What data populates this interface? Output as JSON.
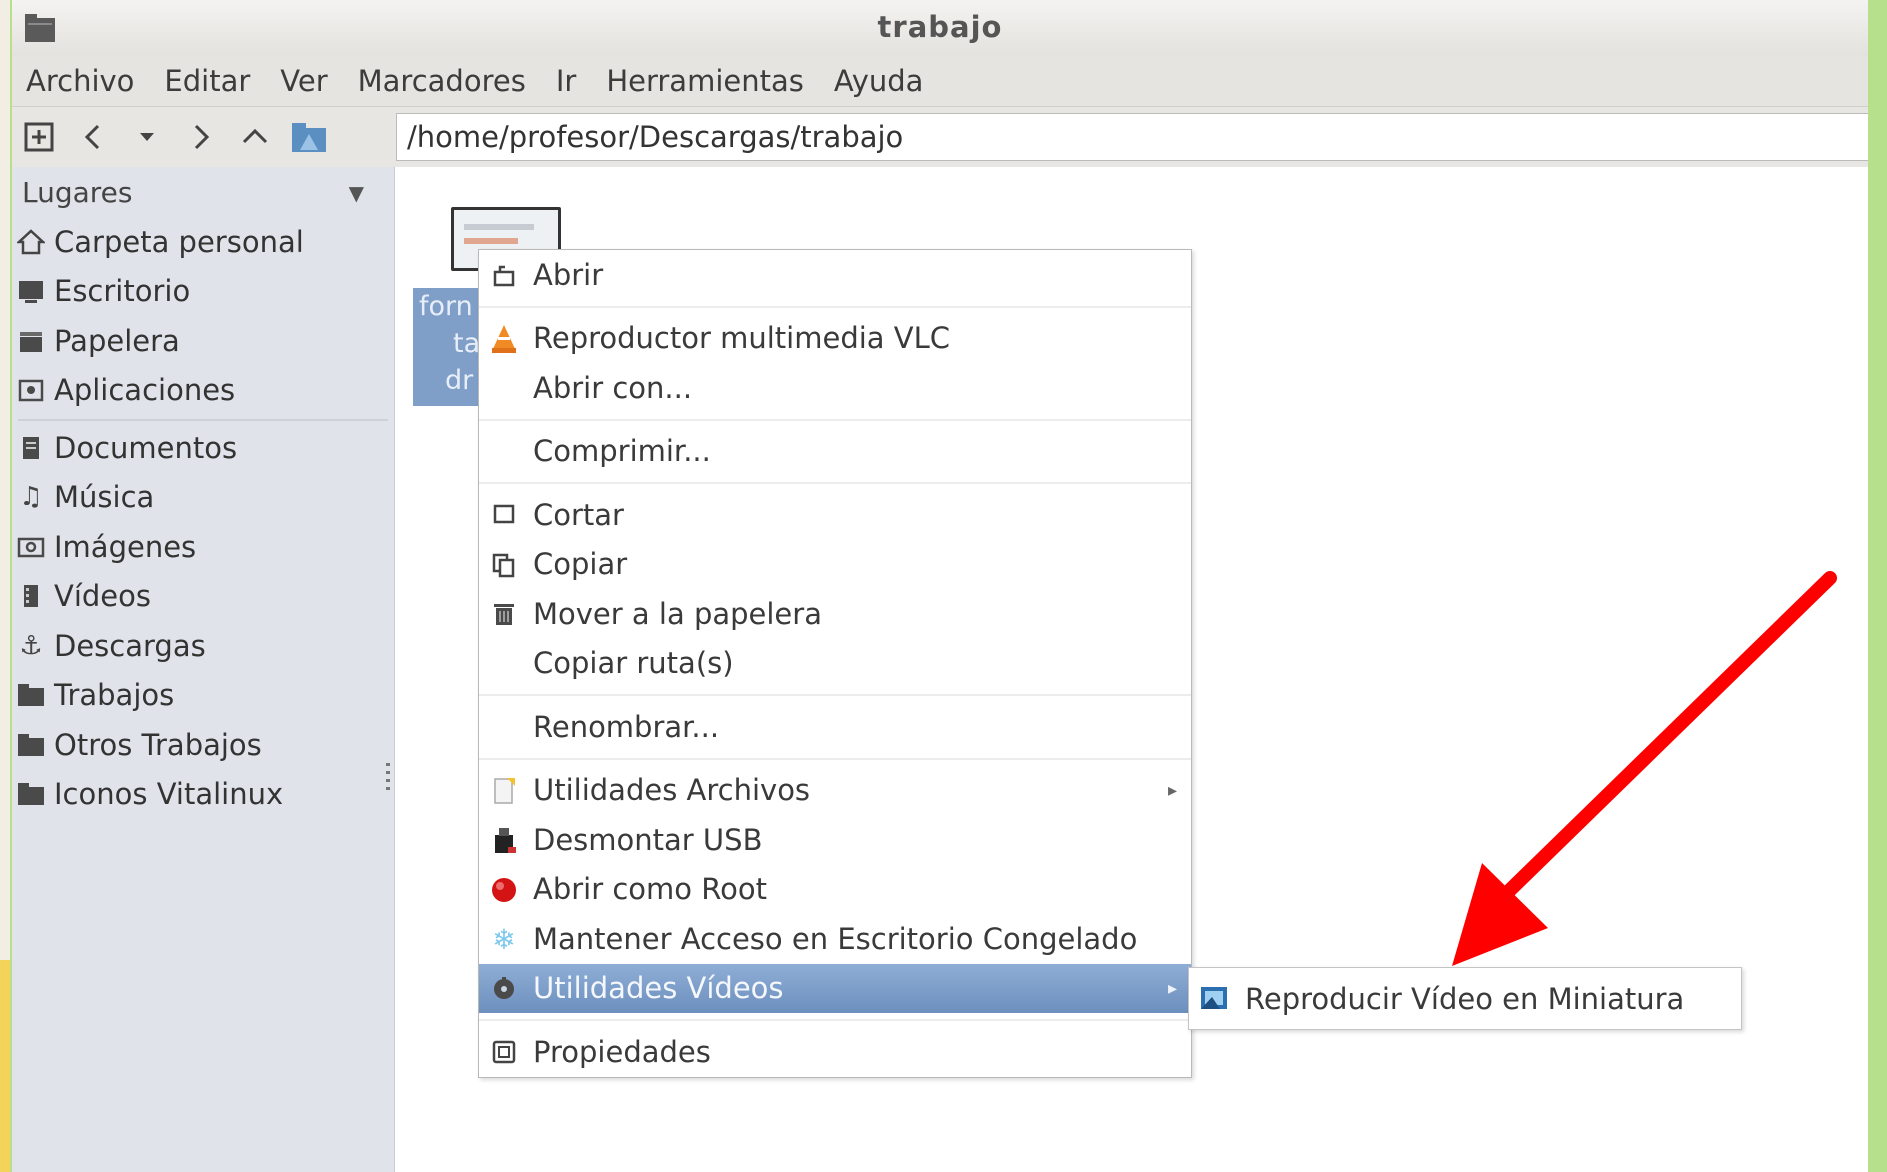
{
  "window": {
    "title": "trabajo"
  },
  "menubar": [
    "Archivo",
    "Editar",
    "Ver",
    "Marcadores",
    "Ir",
    "Herramientas",
    "Ayuda"
  ],
  "toolbar": {
    "path": "/home/profesor/Descargas/trabajo"
  },
  "sidebar": {
    "header": "Lugares",
    "group1": [
      {
        "label": "Carpeta personal",
        "icon": "home-icon"
      },
      {
        "label": "Escritorio",
        "icon": "desktop-icon"
      },
      {
        "label": "Papelera",
        "icon": "trash-icon"
      },
      {
        "label": "Aplicaciones",
        "icon": "applications-icon"
      }
    ],
    "group2": [
      {
        "label": "Documentos",
        "icon": "documents-icon"
      },
      {
        "label": "Música",
        "icon": "music-icon"
      },
      {
        "label": "Imágenes",
        "icon": "pictures-icon"
      },
      {
        "label": "Vídeos",
        "icon": "videos-icon"
      },
      {
        "label": "Descargas",
        "icon": "downloads-icon"
      },
      {
        "label": "Trabajos",
        "icon": "folder-icon"
      },
      {
        "label": "Otros Trabajos",
        "icon": "folder-icon"
      },
      {
        "label": "Iconos Vitalinux",
        "icon": "folder-icon"
      }
    ]
  },
  "file": {
    "label_lines": [
      "forn",
      "ta",
      "dr"
    ]
  },
  "context_menu": {
    "abrir": "Abrir",
    "vlc": "Reproductor multimedia VLC",
    "abrir_con": "Abrir con...",
    "comprimir": "Comprimir...",
    "cortar": "Cortar",
    "copiar": "Copiar",
    "papelera": "Mover a la papelera",
    "copiar_ruta": "Copiar ruta(s)",
    "renombrar": "Renombrar...",
    "util_archivos": "Utilidades Archivos",
    "desmontar": "Desmontar USB",
    "root": "Abrir como Root",
    "congelado": "Mantener Acceso en Escritorio Congelado",
    "util_videos": "Utilidades Vídeos",
    "propiedades": "Propiedades"
  },
  "submenu": {
    "reproducir": "Reproducir Vídeo en Miniatura"
  },
  "colors": {
    "highlight": "#7d9dc8",
    "sidebar_bg": "#e0e4ea",
    "arrow": "#ff0000"
  }
}
